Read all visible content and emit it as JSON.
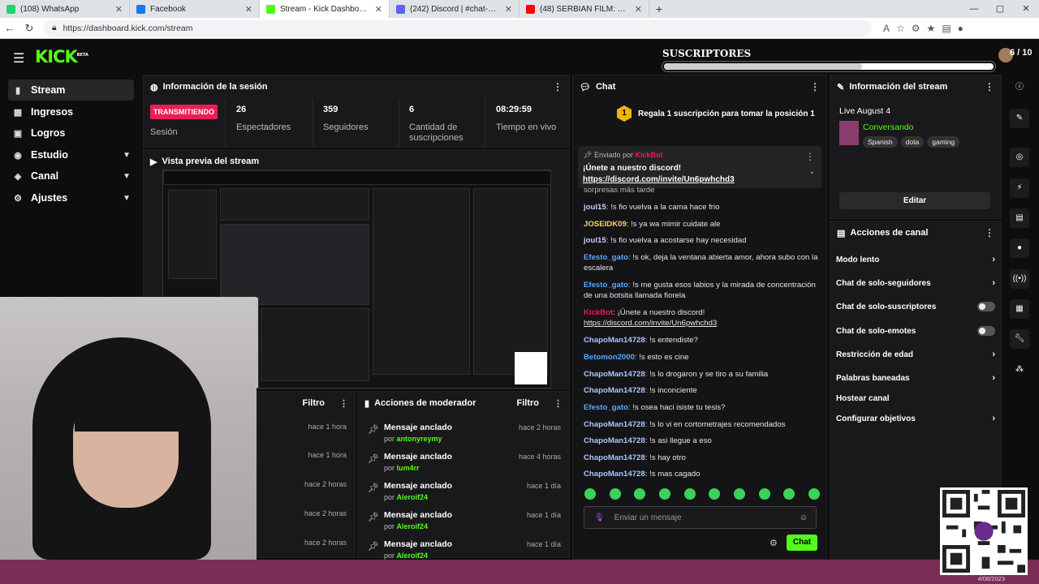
{
  "browser": {
    "tabs": [
      {
        "label": "(108) WhatsApp",
        "color": "#25d366"
      },
      {
        "label": "Facebook",
        "color": "#1877f2"
      },
      {
        "label": "Stream - Kick Dashboard",
        "color": "#53fc18"
      },
      {
        "label": "(242) Discord | #chat-general |",
        "color": "#5865f2"
      },
      {
        "label": "(48) SERBIAN FILM: Un Actor Nop",
        "color": "#ff0000"
      }
    ],
    "url": "https://dashboard.kick.com/stream"
  },
  "app": {
    "logo": "KICK",
    "logo_sup": "BETA",
    "goal_title": "SUSCRIPTORES",
    "goal_count": "6 / 10",
    "goal_progress": 0.6
  },
  "sidebar": {
    "items": [
      {
        "label": "Stream"
      },
      {
        "label": "Ingresos"
      },
      {
        "label": "Logros"
      },
      {
        "label": "Estudio"
      },
      {
        "label": "Canal"
      },
      {
        "label": "Ajustes"
      }
    ]
  },
  "session": {
    "title": "Información de la sesión",
    "live_badge": "TRANSMITIENDO",
    "live_label": "Sesión",
    "viewers": "26",
    "viewers_label": "Espectadores",
    "followers": "359",
    "followers_label": "Seguidores",
    "subs": "6",
    "subs_label": "Cantidad de suscripciones",
    "time": "08:29:59",
    "time_label": "Tiempo en vivo"
  },
  "preview": {
    "title": "Vista previa del stream"
  },
  "filter_left": {
    "label": "Filtro",
    "times": [
      "hace 1 hora",
      "hace 1 hora",
      "hace 2 horas",
      "hace 2 horas",
      "hace 2 horas"
    ]
  },
  "mod_actions": {
    "title": "Acciones de moderador",
    "filter": "Filtro",
    "rows": [
      {
        "title": "Mensaje anclado",
        "by": "por",
        "user": "antonyreymy",
        "ago": "hace 2 horas"
      },
      {
        "title": "Mensaje anclado",
        "by": "por",
        "user": "lum4rr",
        "ago": "hace 4 horas"
      },
      {
        "title": "Mensaje anclado",
        "by": "por",
        "user": "Aleroif24",
        "ago": "hace 1 día"
      },
      {
        "title": "Mensaje anclado",
        "by": "por",
        "user": "Aleroif24",
        "ago": "hace 1 día"
      },
      {
        "title": "Mensaje anclado",
        "by": "por",
        "user": "Aleroif24",
        "ago": "hace 1 día"
      }
    ]
  },
  "chat": {
    "title": "Chat",
    "gift_text": "Regala 1 suscripción para tomar la posición 1",
    "pinned_by": "Enviado por",
    "pinned_user": "KickBot",
    "pinned_text": "¡Únete a nuestro discord!",
    "pinned_link": "https://discord.com/invite/Un6pwhchd3",
    "partial_line": "sorpresas más tarde",
    "messages": [
      {
        "user": "joul15",
        "color": "#c9c9ff",
        "text": "!s fio vuelva a la cama hace frio"
      },
      {
        "user": "JOSEIDK09",
        "color": "#f5d76e",
        "text": "!s ya wa mimir cuidate ale"
      },
      {
        "user": "joul15",
        "color": "#c9c9ff",
        "text": "!s fio vuelva a acostarse hay necesidad"
      },
      {
        "user": "Efesto_gato",
        "color": "#5aa7ff",
        "text": "!s ok, deja la ventana abierta amor, ahora subo con la escalera"
      },
      {
        "user": "Efesto_gato",
        "color": "#5aa7ff",
        "text": "!s me gusta esos labios y la mirada de concentración de una botsita llamada fiorela"
      },
      {
        "user": "KickBot",
        "color": "#e91e55",
        "text": "¡Únete a nuestro discord!",
        "link": "https://discord.com/invite/Un6pwhchd3"
      },
      {
        "user": "ChapoMan14728",
        "color": "#a8c7ff",
        "text": "!s entendiste?"
      },
      {
        "user": "Betomon2000",
        "color": "#5aa7ff",
        "text": "!s esto es cine"
      },
      {
        "user": "ChapoMan14728",
        "color": "#a8c7ff",
        "text": "!s lo drogaron y se tiro a su familia"
      },
      {
        "user": "ChapoMan14728",
        "color": "#a8c7ff",
        "text": "!s inconciente"
      },
      {
        "user": "Efesto_gato",
        "color": "#5aa7ff",
        "text": "!s osea haci isiste tu tesis?"
      },
      {
        "user": "ChapoMan14728",
        "color": "#a8c7ff",
        "text": "!s lo vi en cortometrajes recomendados"
      },
      {
        "user": "ChapoMan14728",
        "color": "#a8c7ff",
        "text": "!s asi llegue a eso"
      },
      {
        "user": "ChapoMan14728",
        "color": "#a8c7ff",
        "text": "!s hay otro"
      },
      {
        "user": "ChapoMan14728",
        "color": "#a8c7ff",
        "text": "!s mas cagado"
      }
    ],
    "input_placeholder": "Enviar un mensaje",
    "send_label": "Chat"
  },
  "stream_info": {
    "title": "Información del stream",
    "stream_title": "Live August 4",
    "category": "Conversando",
    "tags": [
      "Spanish",
      "dota",
      "gaming"
    ],
    "edit_label": "Editar"
  },
  "channel_actions": {
    "title": "Acciones de canal",
    "items": [
      {
        "label": "Modo lento",
        "kind": "chevron"
      },
      {
        "label": "Chat de solo-seguidores",
        "kind": "chevron"
      },
      {
        "label": "Chat de solo-suscriptores",
        "kind": "toggle"
      },
      {
        "label": "Chat de solo-emotes",
        "kind": "toggle"
      },
      {
        "label": "Restricción de edad",
        "kind": "chevron"
      },
      {
        "label": "Palabras baneadas",
        "kind": "chevron"
      },
      {
        "label": "Hostear canal",
        "kind": "none"
      },
      {
        "label": "Configurar objetivos",
        "kind": "chevron"
      }
    ]
  },
  "taskbar": {
    "date": "4/08/2023"
  }
}
